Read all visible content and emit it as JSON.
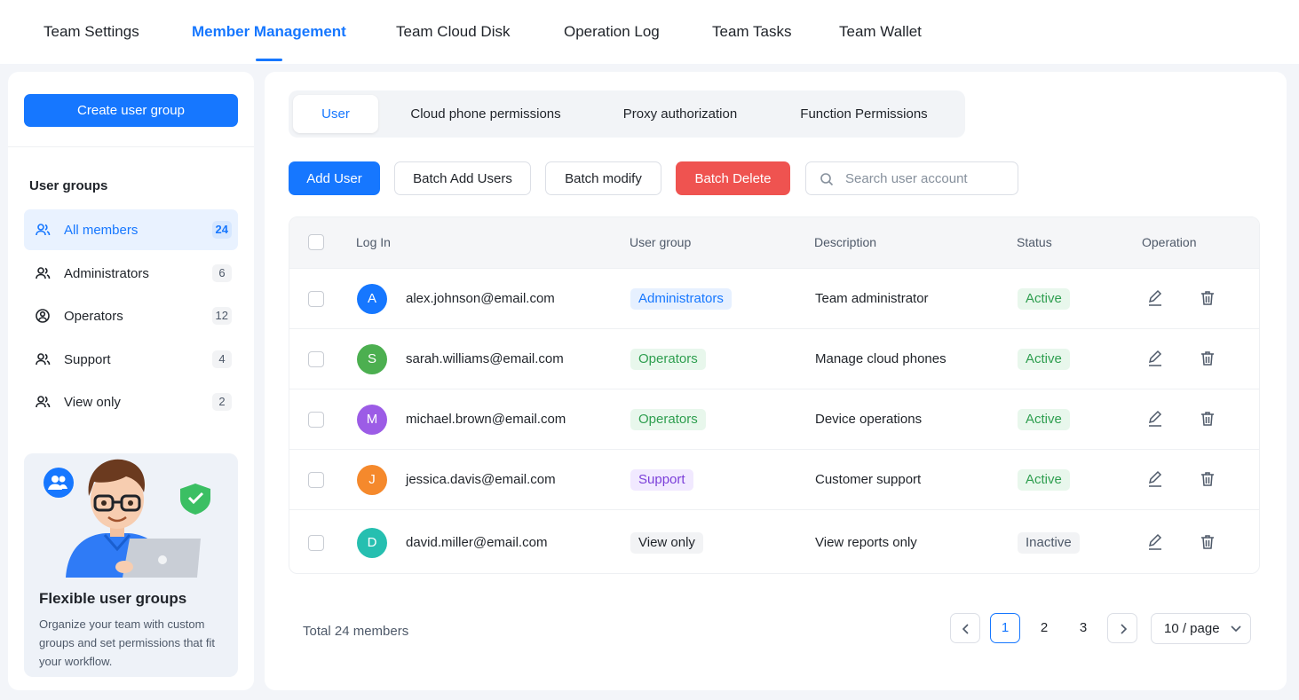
{
  "top_nav": {
    "tabs": [
      {
        "label": "Team Settings"
      },
      {
        "label": "Member Management",
        "active": true
      },
      {
        "label": "Team Cloud Disk"
      },
      {
        "label": "Operation Log"
      },
      {
        "label": "Team Tasks"
      },
      {
        "label": "Team Wallet"
      }
    ]
  },
  "sidebar": {
    "create_button": "Create user group",
    "groups_title": "User groups",
    "groups": [
      {
        "label": "All members",
        "count": "24",
        "icon": "users-icon",
        "active": true
      },
      {
        "label": "Administrators",
        "count": "6",
        "icon": "user-admin-icon"
      },
      {
        "label": "Operators",
        "count": "12",
        "icon": "operator-icon"
      },
      {
        "label": "Support",
        "count": "4",
        "icon": "user-support-icon"
      },
      {
        "label": "View only",
        "count": "2",
        "icon": "user-view-icon"
      }
    ],
    "promo": {
      "title": "Flexible user groups",
      "text": "Organize your team with custom groups and set permissions that fit your workflow."
    }
  },
  "main": {
    "subtabs": [
      {
        "label": "User",
        "active": true
      },
      {
        "label": "Cloud phone permissions"
      },
      {
        "label": "Proxy authorization"
      },
      {
        "label": "Function Permissions"
      }
    ],
    "toolbar": {
      "add_user": "Add User",
      "batch_add": "Batch Add Users",
      "batch_modify": "Batch modify",
      "batch_delete": "Batch Delete",
      "search_placeholder": "Search user account"
    },
    "table": {
      "columns": [
        "Log In",
        "User group",
        "Description",
        "Status",
        "Operation"
      ],
      "rows": [
        {
          "initial": "A",
          "avatar_color": "#1677ff",
          "email": "alex.johnson@email.com",
          "group": "Administrators",
          "group_style": "blue",
          "description": "Team administrator",
          "status": "Active"
        },
        {
          "initial": "S",
          "avatar_color": "#4caf50",
          "email": "sarah.williams@email.com",
          "group": "Operators",
          "group_style": "green",
          "description": "Manage cloud phones",
          "status": "Active"
        },
        {
          "initial": "M",
          "avatar_color": "#9c5ce6",
          "email": "michael.brown@email.com",
          "group": "Operators",
          "group_style": "green",
          "description": "Device operations",
          "status": "Active"
        },
        {
          "initial": "J",
          "avatar_color": "#f5892c",
          "email": "jessica.davis@email.com",
          "group": "Support",
          "group_style": "purple",
          "description": "Customer support",
          "status": "Active"
        },
        {
          "initial": "D",
          "avatar_color": "#26bfb0",
          "email": "david.miller@email.com",
          "group": "View only",
          "group_style": "gray",
          "description": "View reports only",
          "status": "Inactive"
        }
      ]
    },
    "footer": {
      "total": "Total 24 members",
      "pages": [
        "1",
        "2",
        "3"
      ],
      "current_page": "1",
      "page_size": "10 / page"
    }
  },
  "colors": {
    "primary": "#1677ff",
    "danger": "#ef5350",
    "active_status_bg": "#e8f7ec",
    "active_status_text": "#2e9e4f"
  }
}
